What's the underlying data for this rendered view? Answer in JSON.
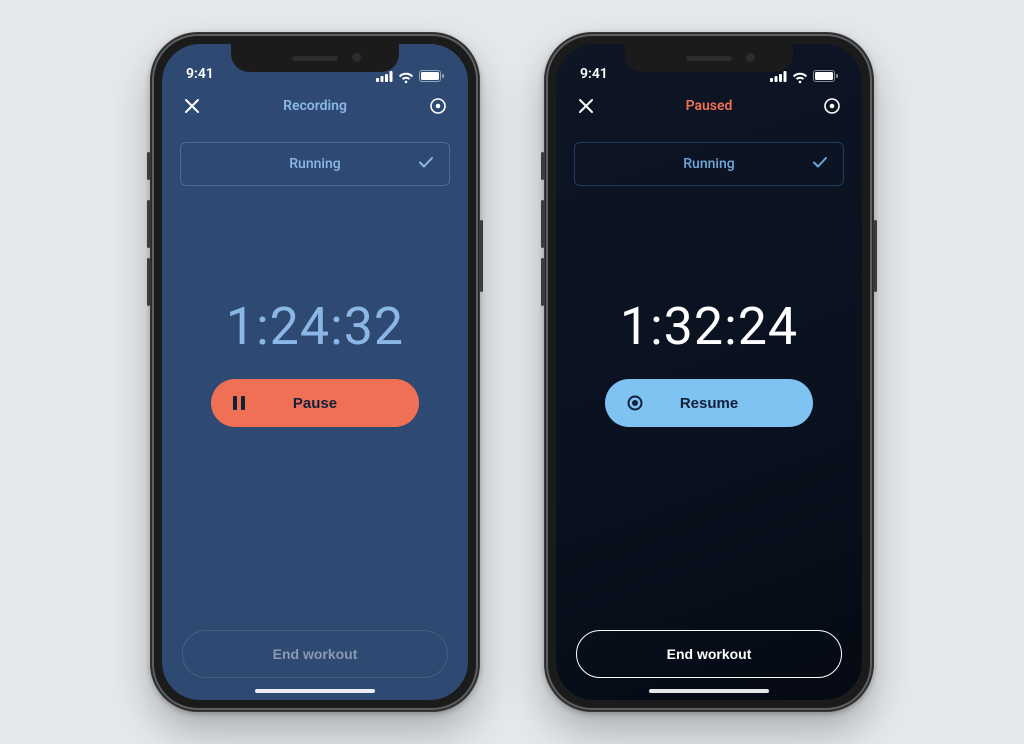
{
  "statusbar": {
    "time": "9:41"
  },
  "phones": [
    {
      "state": "recording",
      "nav_title": "Recording",
      "activity_label": "Running",
      "timer": "1:24:32",
      "action_label": "Pause",
      "action_kind": "pause",
      "end_label": "End workout"
    },
    {
      "state": "paused",
      "nav_title": "Paused",
      "activity_label": "Running",
      "timer": "1:32:24",
      "action_label": "Resume",
      "action_kind": "resume",
      "end_label": "End workout"
    }
  ],
  "colors": {
    "bg_recording": "#2f4a72",
    "bg_paused_top": "#0e1626",
    "accent_blue": "#8bb7e6",
    "accent_red": "#f07055",
    "resume_blue": "#7ec3f2"
  }
}
